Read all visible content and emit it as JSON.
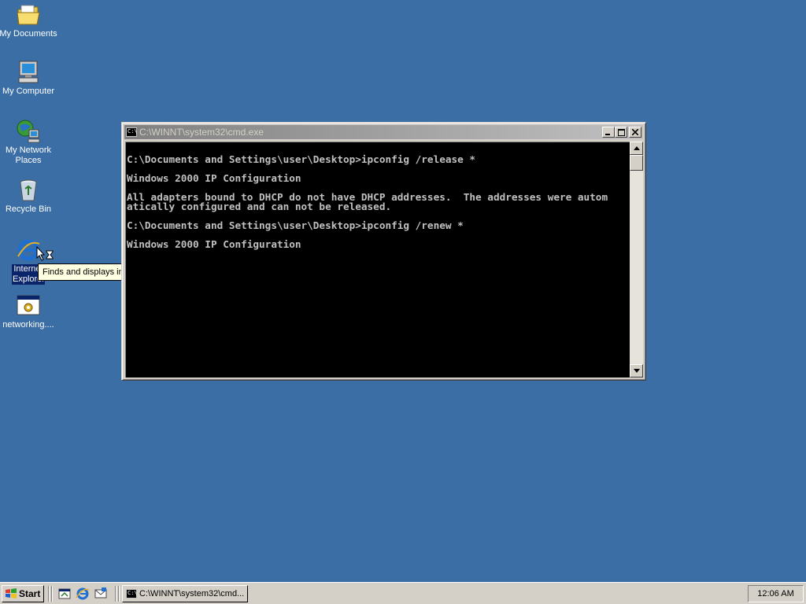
{
  "desktop": {
    "background": "#3a6ea5",
    "icons": [
      {
        "label": "My Documents",
        "icon": "folder-documents-icon"
      },
      {
        "label": "My Computer",
        "icon": "computer-icon"
      },
      {
        "label": "My Network Places",
        "icon": "network-places-icon"
      },
      {
        "label": "Recycle Bin",
        "icon": "recycle-bin-icon"
      },
      {
        "label": "Internet Explorer",
        "icon": "internet-explorer-icon"
      },
      {
        "label": "networking....",
        "icon": "shortcut-icon"
      }
    ]
  },
  "tooltip": {
    "text": "Finds and displays information and Web sites on the Internet"
  },
  "window": {
    "title": "C:\\WINNT\\system32\\cmd.exe",
    "icon_text": "C:\\",
    "buttons": {
      "minimize": "_",
      "maximize": "□",
      "close": "×"
    },
    "console_lines": [
      "",
      "C:\\Documents and Settings\\user\\Desktop>ipconfig /release *",
      "",
      "Windows 2000 IP Configuration",
      "",
      "All adapters bound to DHCP do not have DHCP addresses.  The addresses were autom",
      "atically configured and can not be released.",
      "",
      "C:\\Documents and Settings\\user\\Desktop>ipconfig /renew *",
      "",
      "Windows 2000 IP Configuration"
    ]
  },
  "taskbar": {
    "start_label": "Start",
    "quick_launch": [
      "show-desktop-icon",
      "internet-explorer-icon",
      "outlook-express-icon"
    ],
    "tasks": [
      {
        "label": "C:\\WINNT\\system32\\cmd...",
        "icon": "cmd-icon"
      }
    ],
    "clock": "12:06 AM"
  }
}
